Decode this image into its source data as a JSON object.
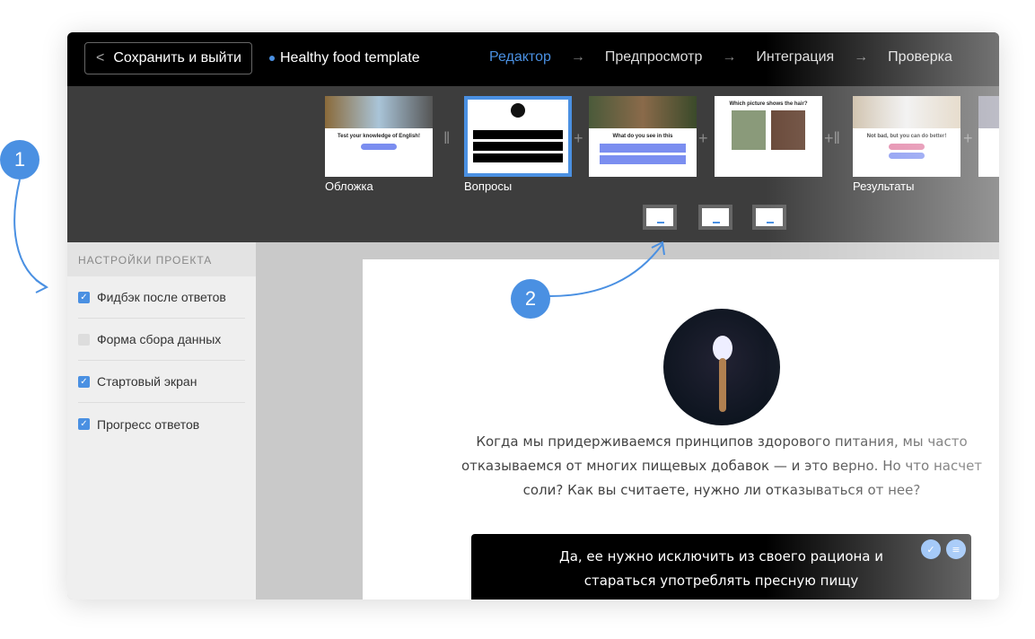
{
  "topbar": {
    "back_label": "Сохранить и выйти",
    "project_name": "Healthy food template",
    "steps": [
      "Редактор",
      "Предпросмотр",
      "Интеграция",
      "Проверка"
    ]
  },
  "filmstrip": {
    "thumbs": [
      {
        "label": "Обложка",
        "title": "Test your knowledge of English!"
      },
      {
        "label": "Вопросы",
        "title": ""
      },
      {
        "label": "",
        "title": "What do you see in this"
      },
      {
        "label": "",
        "title": "Which picture shows the hair?"
      },
      {
        "label": "Результаты",
        "title": "Not bad, but you can do better!"
      }
    ]
  },
  "sidebar": {
    "header": "НАСТРОЙКИ ПРОЕКТА",
    "options": [
      {
        "label": "Фидбэк после ответов",
        "checked": true
      },
      {
        "label": "Форма сбора данных",
        "checked": false
      },
      {
        "label": "Стартовый экран",
        "checked": true
      },
      {
        "label": "Прогресс ответов",
        "checked": true
      }
    ]
  },
  "question": {
    "text": "Когда мы придерживаемся принципов здорового питания, мы часто отказываемся от многих пищевых добавок — и это верно. Но что насчет соли? Как вы считаете, нужно ли отказываться от нее?",
    "answer": "Да, ее нужно исключить из своего рациона и стараться употреблять пресную пищу"
  },
  "annotations": [
    "1",
    "2"
  ],
  "colors": {
    "accent": "#4a90e2"
  }
}
